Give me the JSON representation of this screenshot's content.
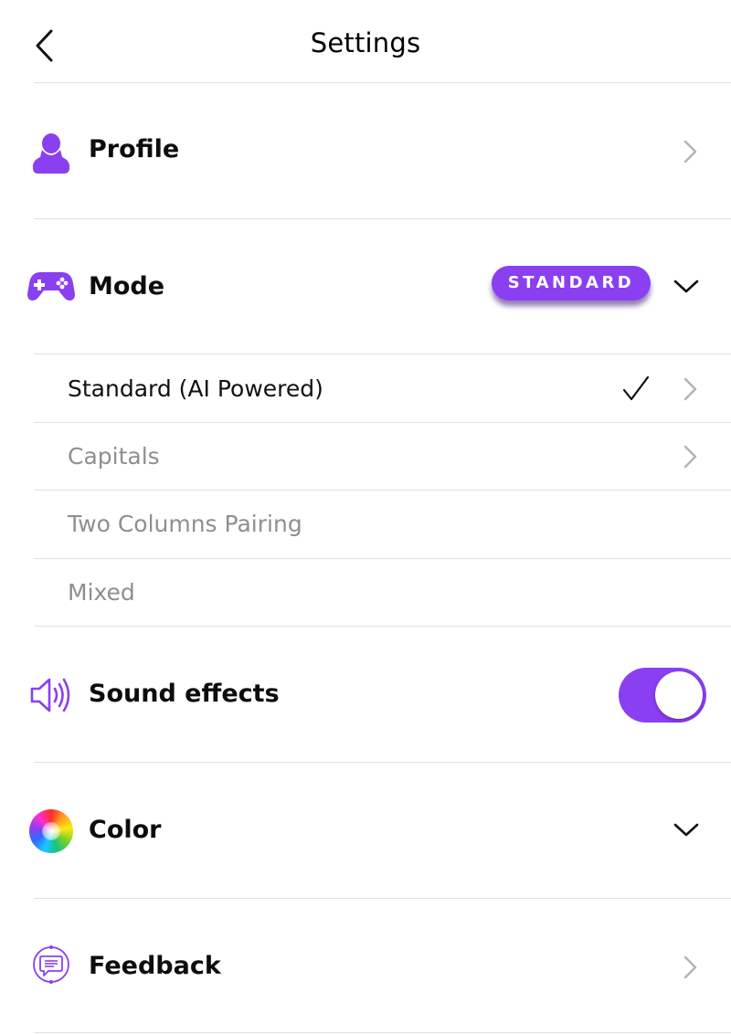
{
  "header": {
    "title": "Settings",
    "back_icon": "chevron-left-icon"
  },
  "profile": {
    "label": "Profile",
    "icon": "person-icon"
  },
  "mode": {
    "label": "Mode",
    "icon": "gamepad-icon",
    "badge": "STANDARD",
    "options": [
      {
        "label": "Standard (AI Powered)",
        "selected": true,
        "has_chevron": true
      },
      {
        "label": "Capitals",
        "selected": false,
        "has_chevron": true
      },
      {
        "label": "Two Columns Pairing",
        "selected": false,
        "has_chevron": false
      },
      {
        "label": "Mixed",
        "selected": false,
        "has_chevron": false
      }
    ]
  },
  "sound": {
    "label": "Sound effects",
    "icon": "speaker-icon",
    "enabled": true
  },
  "color": {
    "label": "Color",
    "icon": "color-wheel-icon"
  },
  "feedback": {
    "label": "Feedback",
    "icon": "chat-bubble-icon"
  },
  "colors": {
    "accent": "#8a3ff1",
    "muted_text": "#8e8e93",
    "divider": "#e1e1e1",
    "chevron": "#b3b3b8"
  }
}
